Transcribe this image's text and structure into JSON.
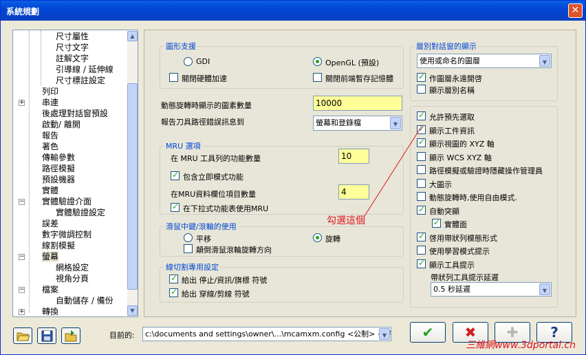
{
  "window": {
    "title": "系統規劃",
    "close": "✕"
  },
  "tree": {
    "items": [
      {
        "label": "尺寸屬性"
      },
      {
        "label": "尺寸文字"
      },
      {
        "label": "註解文字"
      },
      {
        "label": "引導線 / 延伸線"
      },
      {
        "label": "尺寸標註設定"
      },
      {
        "label": "列印"
      },
      {
        "label": "串連"
      },
      {
        "label": "後處理對話窗預設"
      },
      {
        "label": "啟動/ 離開"
      },
      {
        "label": "報告"
      },
      {
        "label": "著色"
      },
      {
        "label": "傳輸參數"
      },
      {
        "label": "路徑模擬"
      },
      {
        "label": "預設機器"
      },
      {
        "label": "實體"
      },
      {
        "label": "實體驗證介面"
      },
      {
        "label": "實體驗證設定"
      },
      {
        "label": "誤差"
      },
      {
        "label": "數字微調控制"
      },
      {
        "label": "線割模擬"
      },
      {
        "label": "螢幕"
      },
      {
        "label": "網格設定"
      },
      {
        "label": "視角分頁"
      },
      {
        "label": "檔案"
      },
      {
        "label": "自動儲存 / 備份"
      },
      {
        "label": "轉換"
      }
    ]
  },
  "graphics": {
    "legend": "圖形支援",
    "gdi": "GDI",
    "opengl": "OpenGL (預設)",
    "disable_hw": "關閉硬體加速",
    "disable_front": "關閉前端暫存記憶體"
  },
  "dynamic": {
    "label": "動態旋轉時顯示的圖素數量",
    "value": "10000"
  },
  "report": {
    "label": "報告刀具路徑錯誤訊息到",
    "value": "螢幕和登錄檔"
  },
  "mru": {
    "legend": "MRU 選項",
    "toolbar_label": "在 MRU 工具列的功能數量",
    "toolbar_value": "10",
    "include_immediate": "包含立即模式功能",
    "field_label": "在MRU資料欄位項目數量",
    "field_value": "4",
    "use_dropdown": "在下拉式功能表使用MRU"
  },
  "wheel": {
    "legend": "滑鼠中鍵/滾輪的使用",
    "pan": "平移",
    "rotate": "旋轉",
    "reverse": "顛倒滑鼠滾輪旋轉方向"
  },
  "wire": {
    "legend": "線切割專用設定",
    "opt1": "給出 停止/資訊/旗標 符號",
    "opt2": "給出 穿線/剪線 符號"
  },
  "layer": {
    "legend": "層別對話窗的顯示",
    "select": "使用或命名的圖層",
    "always_fast": "作圖層永遠開啓",
    "show_names": "顯示層別名稱"
  },
  "options": [
    {
      "label": "允許預先選取",
      "checked": true
    },
    {
      "label": "顯示工件資訊",
      "checked": true
    },
    {
      "label": "顯示視圖的 XYZ 軸",
      "checked": true
    },
    {
      "label": "顯示 WCS XYZ 軸",
      "checked": false
    },
    {
      "label": "路徑模擬或驗證時隱藏操作管理員",
      "checked": false
    },
    {
      "label": "大圖示",
      "checked": false
    },
    {
      "label": "動態旋轉時,使用自由模式.",
      "checked": false
    },
    {
      "label": "自動突顯",
      "checked": true
    },
    {
      "label": "實體面",
      "checked": true
    },
    {
      "label": "啓用帶狀列模態形式",
      "checked": true
    },
    {
      "label": "使用學習模式提示",
      "checked": false
    },
    {
      "label": "顯示工具提示",
      "checked": true
    }
  ],
  "tooltip_delay": {
    "label": "帶狀列工具提示延遲",
    "value": "0.5 秒延遲"
  },
  "annotation": "勾選這個",
  "bottom": {
    "current_label": "目前的:",
    "current_value": "c:\\documents and settings\\owner\\...\\mcamxm.config <公制> <啓動>",
    "ok": "✔",
    "cancel": "✖",
    "add": "✚",
    "help": "?"
  },
  "watermark": "三維網www.3dportal.cn",
  "colors": {
    "accent": "#0046d5",
    "check": "#21a121",
    "annotation": "#e0121e",
    "highlight": "#ffff99"
  }
}
